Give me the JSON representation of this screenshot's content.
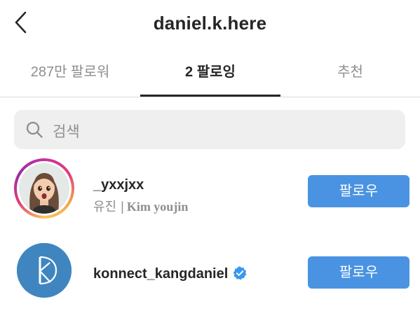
{
  "header": {
    "back_icon": "chevron-left-icon",
    "title": "daniel.k.here"
  },
  "tabs": [
    {
      "label": "287만 팔로워",
      "active": false
    },
    {
      "label": "2 팔로잉",
      "active": true
    },
    {
      "label": "추천",
      "active": false
    }
  ],
  "search": {
    "icon": "search-icon",
    "placeholder": "검색"
  },
  "following": [
    {
      "username": "_yxxjxx",
      "subtitle_ko": "유진",
      "subtitle_sep": "|",
      "subtitle_en": "Kim youjin",
      "has_story_ring": true,
      "verified": false,
      "button_label": "팔로우"
    },
    {
      "username": "konnect_kangdaniel",
      "verified": true,
      "button_label": "팔로우"
    }
  ],
  "colors": {
    "accent_button": "#4a93e2",
    "verified_badge": "#3897f0",
    "logo_background": "#3f86c0",
    "muted_text": "#8e8e8e"
  }
}
